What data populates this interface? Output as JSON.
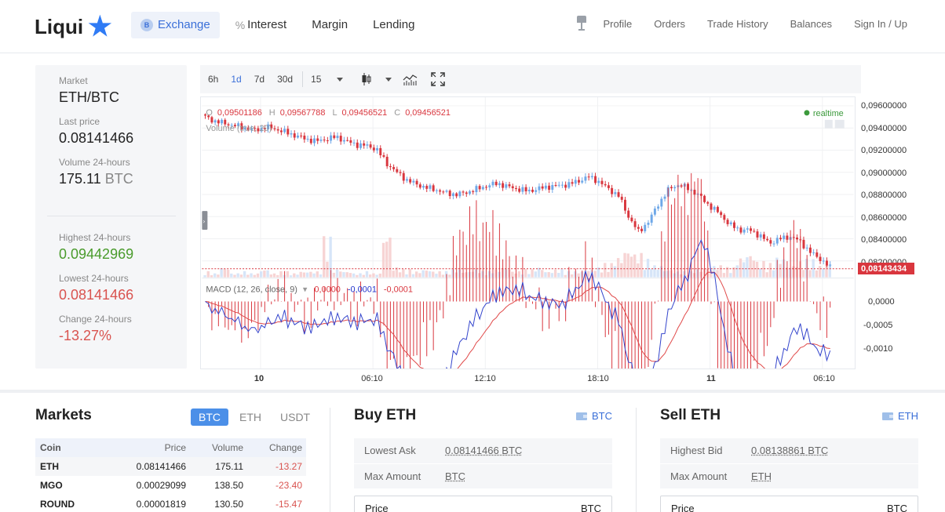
{
  "brand": {
    "name": "Liqui"
  },
  "nav": {
    "main": [
      {
        "label": "Exchange",
        "active": true,
        "icon": "bitcoin-coin-icon"
      },
      {
        "label": "Interest",
        "active": false,
        "icon": "percent-icon"
      },
      {
        "label": "Margin",
        "active": false
      },
      {
        "label": "Lending",
        "active": false
      }
    ],
    "right": [
      "Profile",
      "Orders",
      "Trade History",
      "Balances",
      "Sign In / Up"
    ]
  },
  "market": {
    "label": "Market",
    "pair": "ETH/BTC",
    "last_price_label": "Last price",
    "last_price": "0.08141466",
    "volume_label": "Volume 24-hours",
    "volume_value": "175.11",
    "volume_unit": "BTC",
    "high_label": "Highest 24-hours",
    "high_value": "0.09442969",
    "low_label": "Lowest 24-hours",
    "low_value": "0.08141466",
    "change_label": "Change 24-hours",
    "change_value": "-13.27%"
  },
  "toolbar": {
    "timeframes": [
      "6h",
      "1d",
      "7d",
      "30d"
    ],
    "active_timeframe": "1d",
    "interval": "15"
  },
  "chart_data": {
    "type": "candlestick",
    "ohlc_readout": {
      "o_label": "O",
      "o": "0,09501186",
      "h_label": "H",
      "h": "0,09567788",
      "l_label": "L",
      "l": "0,09456521",
      "c_label": "C",
      "c": "0,09456521"
    },
    "volume_label": "Volume (true, 20)",
    "realtime_label": "realtime",
    "price_axis": [
      "0,09600000",
      "0,09400000",
      "0,09200000",
      "0,09000000",
      "0,08800000",
      "0,08600000",
      "0,08400000",
      "0,08200000"
    ],
    "current_price": "0,08143434",
    "x_ticks": [
      "10",
      "06:10",
      "12:10",
      "18:10",
      "11",
      "06:10"
    ],
    "close_path": [
      0.095,
      0.0946,
      0.0944,
      0.0942,
      0.094,
      0.0938,
      0.0941,
      0.0939,
      0.0936,
      0.0933,
      0.093,
      0.0928,
      0.093,
      0.0932,
      0.0928,
      0.0925,
      0.0924,
      0.0921,
      0.0908,
      0.09,
      0.0893,
      0.0889,
      0.0886,
      0.0884,
      0.0881,
      0.088,
      0.0882,
      0.0885,
      0.0888,
      0.089,
      0.0887,
      0.0885,
      0.0883,
      0.0885,
      0.0887,
      0.0888,
      0.0889,
      0.0892,
      0.0896,
      0.0892,
      0.0885,
      0.0879,
      0.086,
      0.0846,
      0.0856,
      0.0872,
      0.0885,
      0.0889,
      0.0885,
      0.0879,
      0.087,
      0.0863,
      0.0853,
      0.0848,
      0.0848,
      0.0843,
      0.0836,
      0.084,
      0.0842,
      0.0838,
      0.0828,
      0.0822,
      0.0814
    ],
    "volume_spikes": [
      0.3,
      0.2,
      0.5,
      0.2,
      0.3,
      0.2,
      0.4,
      0.2,
      0.3,
      0.2,
      0.3,
      0.3,
      2.0,
      0.4,
      0.3,
      0.2,
      0.3,
      0.2,
      2.2,
      0.5,
      0.4,
      0.3,
      0.4,
      0.3,
      0.3,
      0.4,
      0.3,
      0.4,
      0.3,
      0.4,
      0.5,
      0.3,
      0.4,
      0.5,
      0.3,
      0.4,
      0.3,
      0.3,
      0.4,
      0.5,
      0.7,
      1.0,
      1.4,
      1.2,
      0.9,
      0.6,
      0.4,
      0.3,
      0.3,
      0.4,
      0.5,
      0.6,
      0.5,
      1.0,
      1.2,
      0.8,
      0.7,
      1.0,
      0.6,
      0.8,
      0.9,
      0.6,
      0.7
    ],
    "macd": {
      "label": "MACD (12, 26, close, 9)",
      "values": [
        "0,0000",
        "-0,0001",
        "-0,0001"
      ],
      "axis": [
        "0,0000",
        "-0,0005",
        "-0,0010"
      ]
    }
  },
  "markets": {
    "title": "Markets",
    "tabs": [
      "BTC",
      "ETH",
      "USDT"
    ],
    "active_tab": "BTC",
    "columns": [
      "Coin",
      "Price",
      "Volume",
      "Change"
    ],
    "rows": [
      {
        "coin": "ETH",
        "price": "0.08141466",
        "volume": "175.11",
        "change": "-13.27"
      },
      {
        "coin": "MGO",
        "price": "0.00029099",
        "volume": "138.50",
        "change": "-23.40"
      },
      {
        "coin": "ROUND",
        "price": "0.00001819",
        "volume": "130.50",
        "change": "-15.47"
      }
    ]
  },
  "buy": {
    "title": "Buy ETH",
    "currency": "BTC",
    "row1_label": "Lowest Ask",
    "row1_value": "0.08141466 BTC",
    "row2_label": "Max Amount",
    "row2_value": "BTC",
    "price_label": "Price",
    "price_unit": "BTC"
  },
  "sell": {
    "title": "Sell ETH",
    "currency": "ETH",
    "row1_label": "Highest Bid",
    "row1_value": "0.08138861 BTC",
    "row2_label": "Max Amount",
    "row2_value": "ETH",
    "price_label": "Price",
    "price_unit": "BTC"
  },
  "colors": {
    "up": "#6fa8e8",
    "down": "#d9363e",
    "accent": "#3a6fd8",
    "green": "#4a9b2c"
  }
}
